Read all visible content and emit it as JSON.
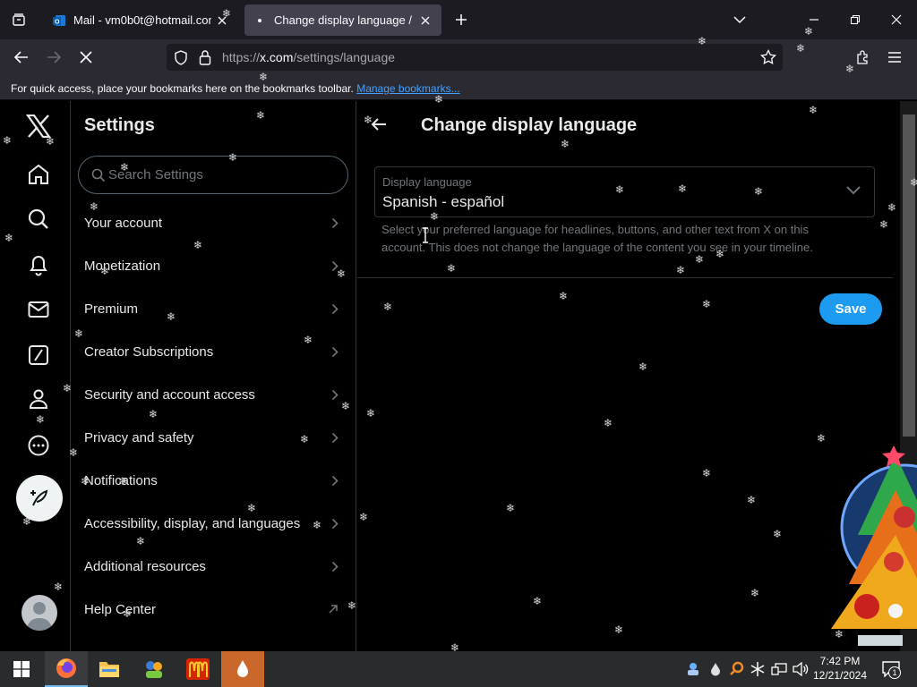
{
  "browser": {
    "tabs": [
      {
        "title": "Mail - vm0b0t@hotmail.com -",
        "active": false,
        "favicon": "outlook-icon"
      },
      {
        "title": "Change display language / X",
        "active": true,
        "favicon": "x-icon"
      }
    ],
    "url": {
      "scheme": "https://",
      "host": "x.com",
      "path": "/settings/language"
    },
    "bookmarks_bar": {
      "text": "For quick access, place your bookmarks here on the bookmarks toolbar.",
      "link": "Manage bookmarks..."
    }
  },
  "settings": {
    "title": "Settings",
    "search_placeholder": "Search Settings",
    "menu": [
      {
        "label": "Your account"
      },
      {
        "label": "Monetization"
      },
      {
        "label": "Premium"
      },
      {
        "label": "Creator Subscriptions"
      },
      {
        "label": "Security and account access"
      },
      {
        "label": "Privacy and safety"
      },
      {
        "label": "Notifications"
      },
      {
        "label": "Accessibility, display, and languages"
      },
      {
        "label": "Additional resources"
      },
      {
        "label": "Help Center"
      }
    ]
  },
  "detail": {
    "title": "Change display language",
    "select_label": "Display language",
    "select_value": "Spanish - español",
    "help_text": "Select your preferred language for headlines, buttons, and other text from X on this account. This does not change the language of the content you see in your timeline.",
    "save_label": "Save"
  },
  "taskbar": {
    "time": "7:42 PM",
    "date": "12/21/2024",
    "notification_count": "1"
  },
  "colors": {
    "accent": "#1d9bf0",
    "background": "#000000",
    "text_primary": "#e7e9ea",
    "text_secondary": "#71767b",
    "border": "#2f3336"
  }
}
